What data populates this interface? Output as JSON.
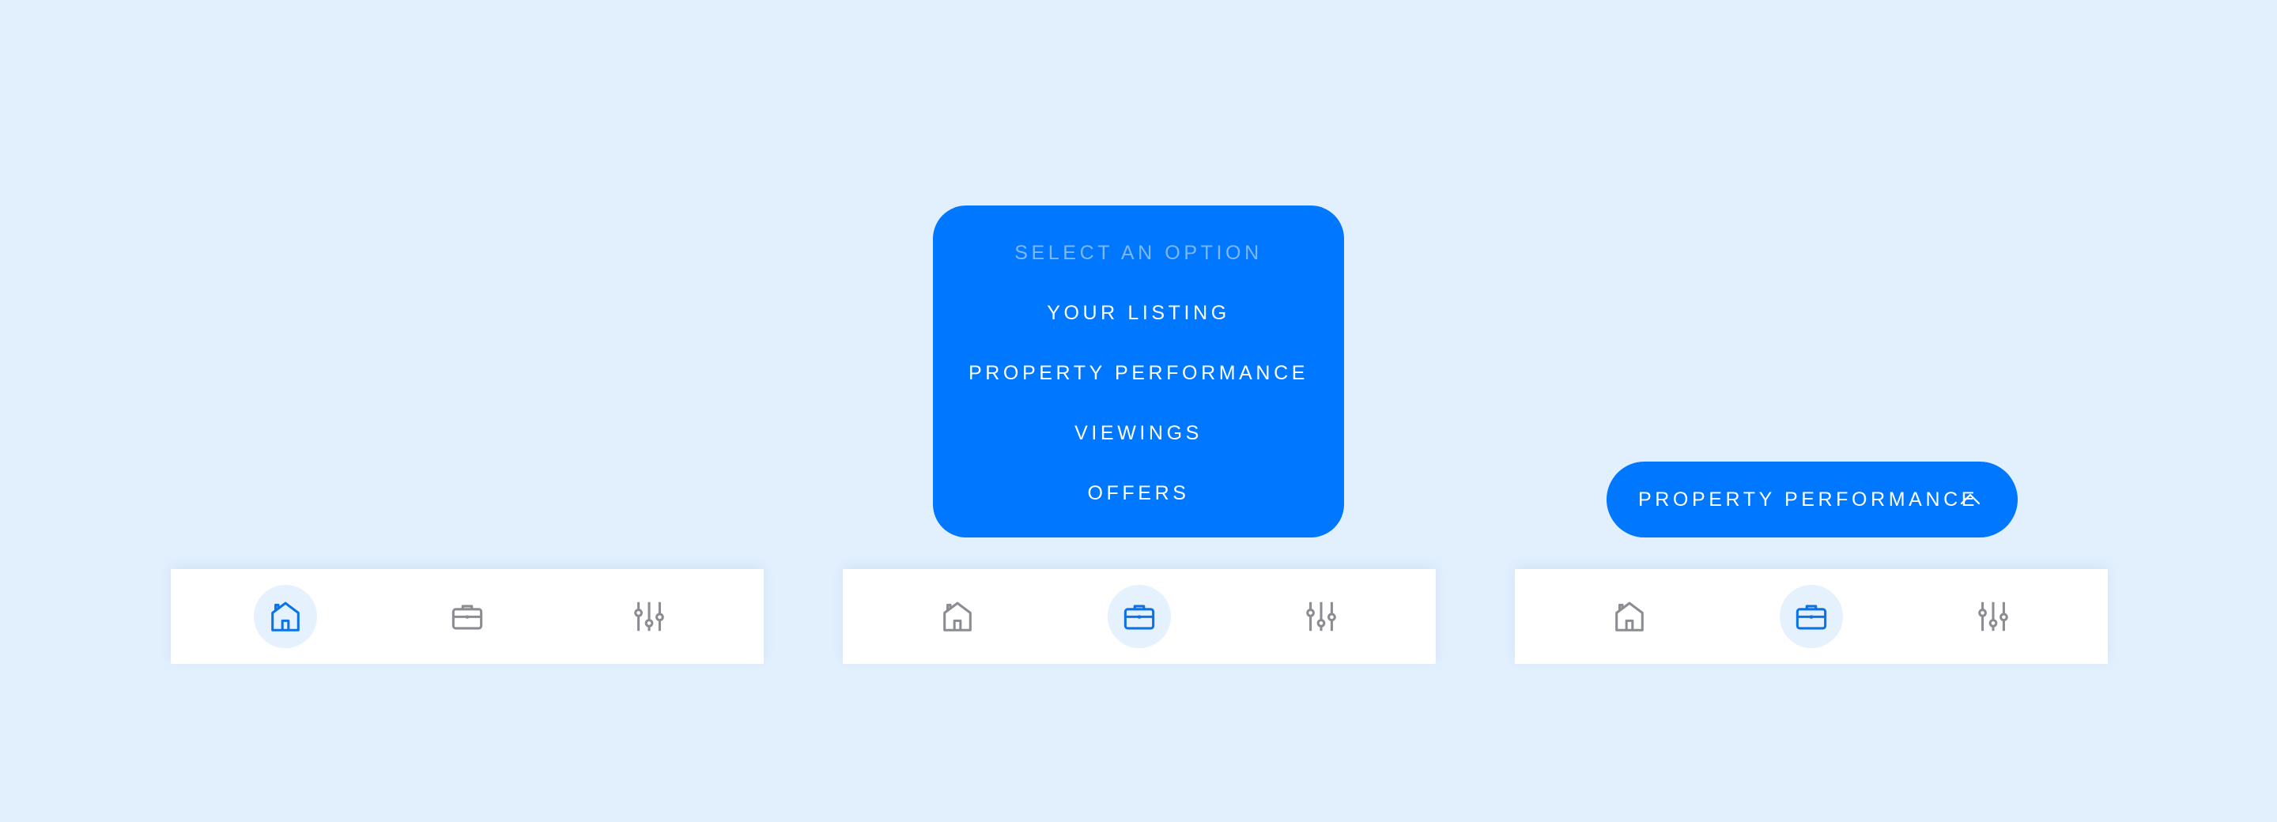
{
  "dropdown": {
    "header": "SELECT AN OPTION",
    "options": [
      "YOUR LISTING",
      "PROPERTY PERFORMANCE",
      "VIEWINGS",
      "OFFERS"
    ],
    "expanded": true
  },
  "select": {
    "value": "PROPERTY PERFORMANCE",
    "chevron_icon": "chevron-up-icon",
    "expanded": false
  },
  "navbars": [
    {
      "active": "home",
      "items": [
        "house-icon",
        "briefcase-icon",
        "sliders-icon"
      ]
    },
    {
      "active": "work",
      "items": [
        "house-icon",
        "briefcase-icon",
        "sliders-icon"
      ]
    },
    {
      "active": "work",
      "items": [
        "house-icon",
        "briefcase-icon",
        "sliders-icon"
      ]
    }
  ],
  "colors": {
    "background": "#E2F0FE",
    "accent": "#0077FF",
    "header_text": "#80B7F6",
    "icon_active": "#0A73E6",
    "icon_inactive": "#8B8D93",
    "active_bubble": "#E5F1FD",
    "navbar": "#FFFFFF"
  }
}
